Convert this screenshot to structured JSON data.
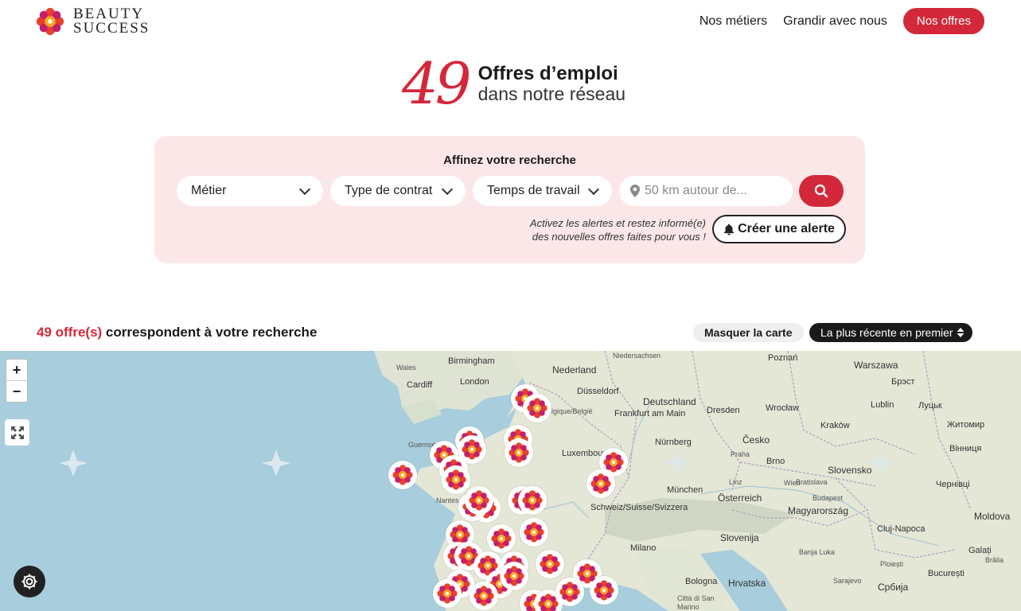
{
  "brand": {
    "line1": "BEAUTY",
    "line2": "SUCCESS",
    "accent": "#d3283a"
  },
  "nav": {
    "item1": "Nos métiers",
    "item2": "Grandir avec nous",
    "cta": "Nos offres"
  },
  "hero": {
    "count": "49",
    "title": "Offres d’emploi",
    "subtitle": "dans notre réseau"
  },
  "search": {
    "title": "Affinez votre recherche",
    "metier": "Métier",
    "contrat": "Type de contrat",
    "temps": "Temps de travail",
    "location_placeholder": "50 km autour de...",
    "alert_line1": "Activez les alertes et restez informé(e)",
    "alert_line2": "des nouvelles offres faites pour vous !",
    "alert_button": "Créer une alerte"
  },
  "results": {
    "count_text": "49 offre(s)",
    "text": " correspondent à votre recherche",
    "hide_map": "Masquer la carte",
    "sort": "La plus récente en premier"
  },
  "map": {
    "zoom_in": "+",
    "zoom_out": "−",
    "cities": [
      "Birmingham",
      "London",
      "Cardiff",
      "Nederland",
      "Düsseldorf",
      "Deutschland",
      "Frankfurt am Main",
      "Luxembourg",
      "Nürnberg",
      "München",
      "Dresden",
      "Wrocław",
      "Kraków",
      "Lublin",
      "Poznań",
      "Warszawa",
      "Česko",
      "Brno",
      "Slovensko",
      "Österreich",
      "Magyarország",
      "Schweiz/Suisse/Svizzera",
      "Milano",
      "Slovenija",
      "Hrvatska",
      "Bologna",
      "Cluj-Napoca",
      "București",
      "Moldova",
      "Чернівці",
      "Житомир",
      "Вінниця",
      "Луцьк",
      "Брэст",
      "Praha",
      "Linz",
      "Wien",
      "Budapest",
      "Bratislava",
      "Sarajevo",
      "Србија",
      "Città di San Marino",
      "Belgique/België",
      "Nantes",
      "Guernsey",
      "Wales",
      "Niedersachsen",
      "Galați",
      "Brăila",
      "Ploiești",
      "Banja Luka"
    ]
  }
}
